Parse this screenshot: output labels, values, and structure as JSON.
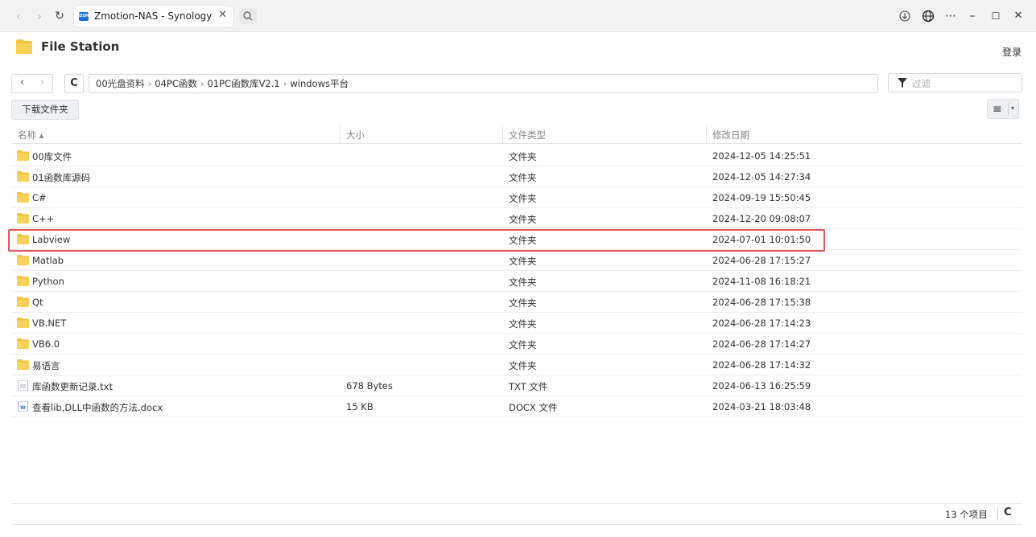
{
  "browser": {
    "tab_title": "Zmotion-NAS - Synology N",
    "favicon_text": "DSM",
    "tab_close": "✕"
  },
  "app": {
    "title": "File Station",
    "login": "登录"
  },
  "toolbar": {
    "path": [
      "00光盘资料",
      "04PC函数",
      "01PC函数库V2.1",
      "windows平台"
    ],
    "path_separator": "›",
    "filter_placeholder": "过滤",
    "download_button": "下载文件夹"
  },
  "table": {
    "headers": {
      "name": "名称 ▴",
      "size": "大小",
      "type": "文件类型",
      "date": "修改日期"
    },
    "rows": [
      {
        "icon": "folder-icon",
        "name": "00库文件",
        "size": "",
        "type": "文件夹",
        "date": "2024-12-05 14:25:51"
      },
      {
        "icon": "folder-icon",
        "name": "01函数库源码",
        "size": "",
        "type": "文件夹",
        "date": "2024-12-05 14:27:34"
      },
      {
        "icon": "folder-icon",
        "name": "C#",
        "size": "",
        "type": "文件夹",
        "date": "2024-09-19 15:50:45"
      },
      {
        "icon": "folder-icon",
        "name": "C++",
        "size": "",
        "type": "文件夹",
        "date": "2024-12-20 09:08:07"
      },
      {
        "icon": "folder-icon",
        "name": "Labview",
        "size": "",
        "type": "文件夹",
        "date": "2024-07-01 10:01:50"
      },
      {
        "icon": "folder-icon",
        "name": "Matlab",
        "size": "",
        "type": "文件夹",
        "date": "2024-06-28 17:15:27"
      },
      {
        "icon": "folder-icon",
        "name": "Python",
        "size": "",
        "type": "文件夹",
        "date": "2024-11-08 16:18:21"
      },
      {
        "icon": "folder-icon",
        "name": "Qt",
        "size": "",
        "type": "文件夹",
        "date": "2024-06-28 17:15:38"
      },
      {
        "icon": "folder-icon",
        "name": "VB.NET",
        "size": "",
        "type": "文件夹",
        "date": "2024-06-28 17:14:23"
      },
      {
        "icon": "folder-icon",
        "name": "VB6.0",
        "size": "",
        "type": "文件夹",
        "date": "2024-06-28 17:14:27"
      },
      {
        "icon": "folder-icon",
        "name": "易语言",
        "size": "",
        "type": "文件夹",
        "date": "2024-06-28 17:14:32"
      },
      {
        "icon": "text-file-icon",
        "name": "库函数更新记录.txt",
        "size": "678 Bytes",
        "type": "TXT 文件",
        "date": "2024-06-13 16:25:59"
      },
      {
        "icon": "word-file-icon",
        "name": "查看lib,DLL中函数的方法.docx",
        "size": "15 KB",
        "type": "DOCX 文件",
        "date": "2024-03-21 18:03:48"
      }
    ]
  },
  "footer": {
    "count": "13 个项目"
  },
  "colors": {
    "folder": "#f5c33b",
    "highlight": "#e05656",
    "word": "#2b5fb3"
  }
}
